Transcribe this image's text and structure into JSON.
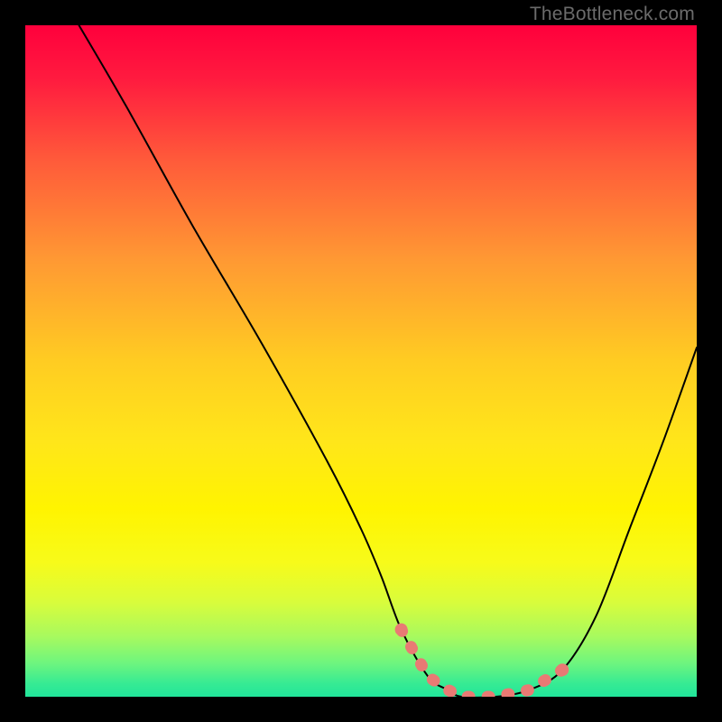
{
  "watermark": "TheBottleneck.com",
  "chart_data": {
    "type": "line",
    "title": "",
    "xlabel": "",
    "ylabel": "",
    "xlim": [
      0,
      100
    ],
    "ylim": [
      0,
      100
    ],
    "grid": false,
    "legend": false,
    "annotations": [],
    "series": [
      {
        "name": "curve",
        "x": [
          8,
          15,
          25,
          35,
          45,
          50,
          53,
          56,
          60,
          63,
          65,
          70,
          75,
          80,
          85,
          90,
          95,
          100
        ],
        "y": [
          100,
          88,
          70,
          53,
          35,
          25,
          18,
          10,
          3,
          1,
          0,
          0,
          1,
          4,
          12,
          25,
          38,
          52
        ]
      }
    ],
    "highlight_segment": {
      "name": "bottom-dots",
      "x": [
        56,
        60,
        63,
        65,
        70,
        75,
        80
      ],
      "y": [
        10,
        3,
        1,
        0,
        0,
        1,
        4
      ]
    },
    "background_gradient": [
      {
        "stop": 0.0,
        "color": "#ff003c"
      },
      {
        "stop": 0.08,
        "color": "#ff1b3f"
      },
      {
        "stop": 0.2,
        "color": "#ff5a3a"
      },
      {
        "stop": 0.35,
        "color": "#ff9933"
      },
      {
        "stop": 0.5,
        "color": "#ffcc22"
      },
      {
        "stop": 0.62,
        "color": "#ffe61a"
      },
      {
        "stop": 0.72,
        "color": "#fff400"
      },
      {
        "stop": 0.8,
        "color": "#f7fb1a"
      },
      {
        "stop": 0.86,
        "color": "#d8fc3c"
      },
      {
        "stop": 0.91,
        "color": "#a8fa5e"
      },
      {
        "stop": 0.95,
        "color": "#6ef57e"
      },
      {
        "stop": 0.98,
        "color": "#37eb93"
      },
      {
        "stop": 1.0,
        "color": "#21e59b"
      }
    ]
  }
}
